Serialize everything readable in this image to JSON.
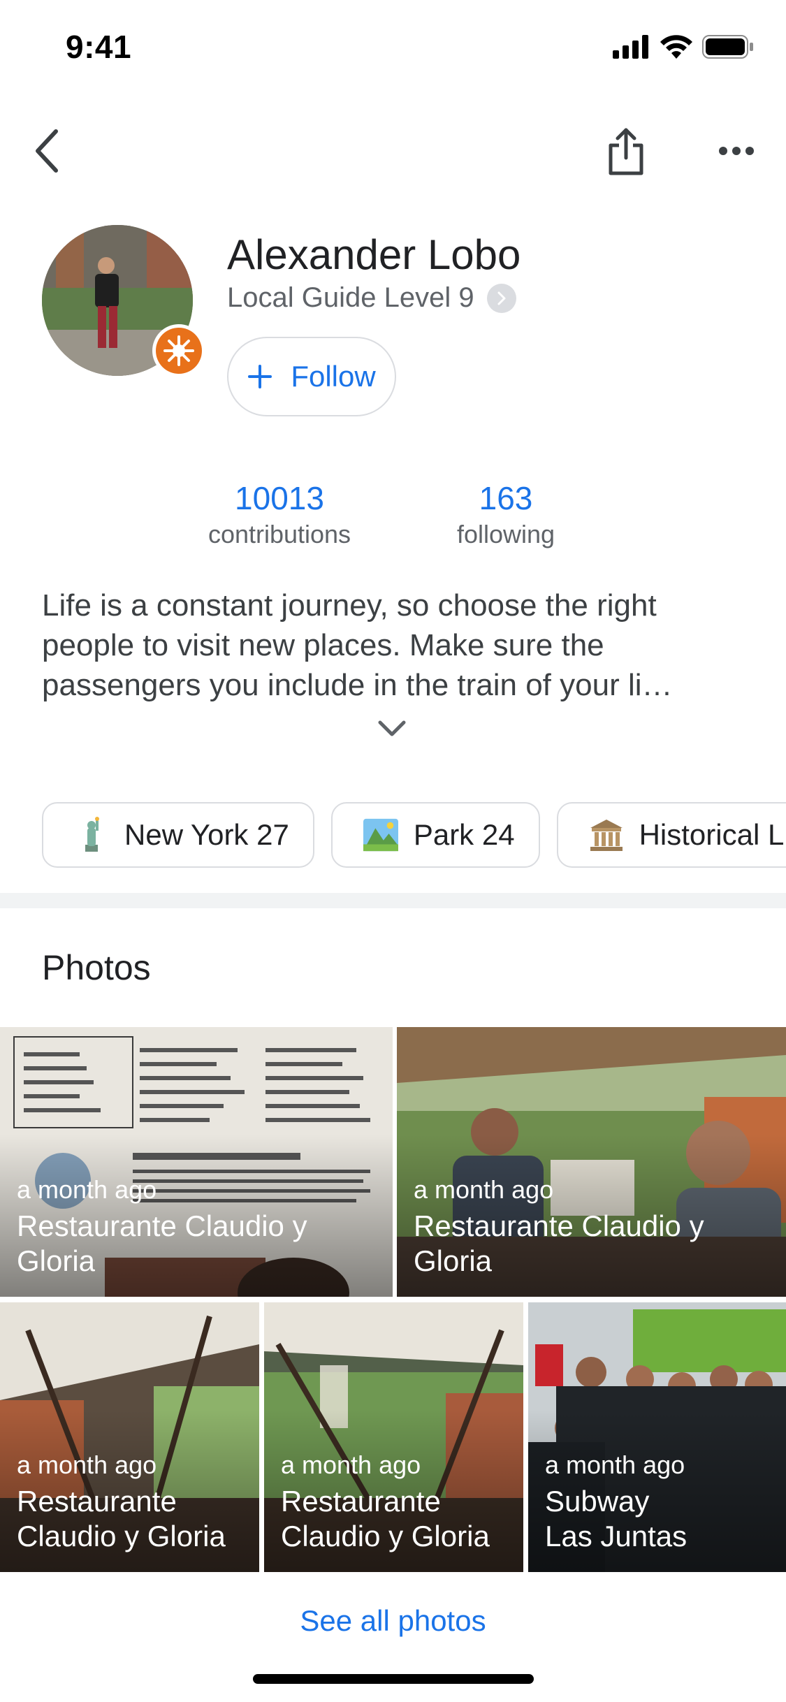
{
  "status_bar": {
    "time": "9:41"
  },
  "profile": {
    "name": "Alexander Lobo",
    "level": "Local Guide Level 9",
    "follow_label": "Follow"
  },
  "stats": [
    {
      "value": "10013",
      "label": "contributions"
    },
    {
      "value": "163",
      "label": "following"
    }
  ],
  "bio": "Life is a constant journey, so choose the right people to visit new places. Make sure the passengers you include in the train of your li…",
  "chips": [
    {
      "icon": "statue-of-liberty-icon",
      "label": "New York 27"
    },
    {
      "icon": "park-icon",
      "label": "Park 24"
    },
    {
      "icon": "classical-building-icon",
      "label": "Historical L"
    }
  ],
  "photos_section": {
    "title": "Photos",
    "see_all_label": "See all photos",
    "tiles": [
      {
        "date": "a month ago",
        "title": "Restaurante Claudio y Gloria"
      },
      {
        "date": "a month ago",
        "title": "Restaurante Claudio y Gloria"
      },
      {
        "date": "a month ago",
        "title": "Restaurante Claudio y Gloria"
      },
      {
        "date": "a month ago",
        "title": "Restaurante Claudio y Gloria"
      },
      {
        "date": "a month ago",
        "title": "Subway Las Juntas"
      }
    ]
  },
  "colors": {
    "accent": "#1a73e8",
    "guide_badge": "#e8711a",
    "divider": "#f1f3f4"
  }
}
